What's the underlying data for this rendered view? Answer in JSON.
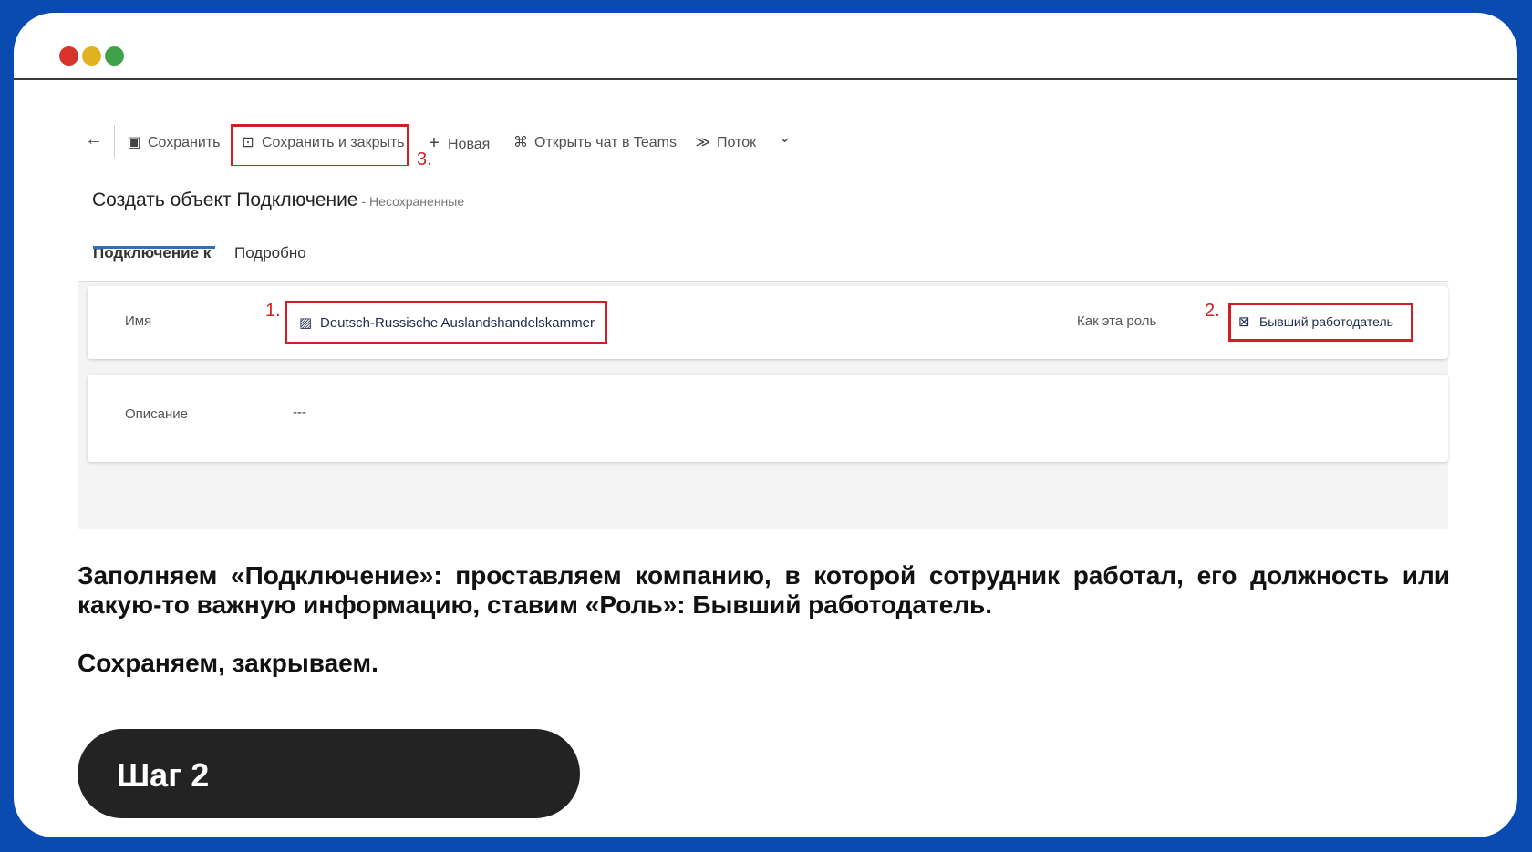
{
  "window": {
    "controls": [
      "close",
      "minimize",
      "maximize"
    ]
  },
  "toolbar": {
    "back_icon": "arrow-left-icon",
    "save_label": "Сохранить",
    "save_close_label": "Сохранить и закрыть",
    "new_label": "Новая",
    "teams_label": "Открыть чат в Teams",
    "flow_label": "Поток",
    "flow_dropdown_icon": "chevron-down-icon"
  },
  "record": {
    "title": "Создать объект Подключение",
    "status": "- Несохраненные"
  },
  "tabs": [
    {
      "label": "Подключение к",
      "active": true
    },
    {
      "label": "Подробно",
      "active": false
    }
  ],
  "form": {
    "name_label": "Имя",
    "name_value": "Deutsch-Russische Auslandshandelskammer",
    "role_label": "Как эта роль",
    "role_value": "Бывший работодатель",
    "description_label": "Описание",
    "description_value": "---"
  },
  "annotations": {
    "step1": "1.",
    "step2": "2.",
    "step3": "3.",
    "color": "#d01f25"
  },
  "instructions": {
    "paragraph1": "Заполняем «Подключение»: проставляем компанию, в которой сотрудник работал, его должность или какую-то важную информацию, ставим «Роль»: Бывший работодатель.",
    "paragraph2": "Сохраняем, закрываем."
  },
  "step": {
    "label": "Шаг 2"
  }
}
